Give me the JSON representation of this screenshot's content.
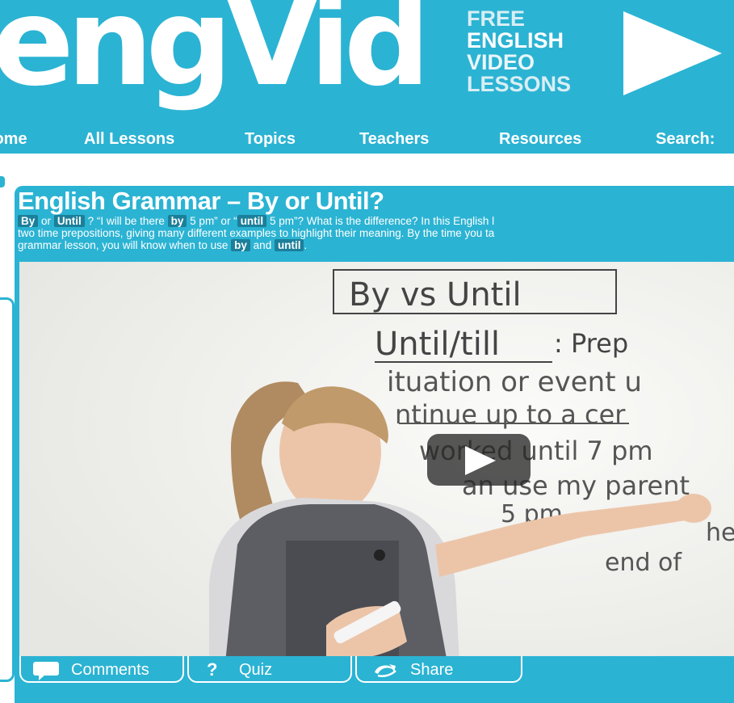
{
  "header": {
    "logo": "engVid",
    "tagline": [
      "FREE",
      "ENGLISH",
      "VIDEO",
      "LESSONS"
    ]
  },
  "nav": {
    "items": [
      "Home",
      "All Lessons",
      "Topics",
      "Teachers",
      "Resources",
      "Search:"
    ]
  },
  "lesson": {
    "title": "English Grammar – By or Until?",
    "desc": {
      "kw_by": "By",
      "w_or": "or",
      "kw_until": "Until",
      "t_quote1": "? “I will be there",
      "kw_by2": "by",
      "t_mid": "5 pm” or “",
      "kw_until2": "until",
      "t_end1": "5 pm”? What is the difference? In this English l",
      "line2": "two time prepositions, giving many different examples to highlight their meaning. By the time you ta",
      "t_line3": "grammar lesson, you will know when to use",
      "kw_by3": "by",
      "w_and": "and",
      "kw_until3": "until",
      "t_period": "."
    }
  },
  "whiteboard": {
    "title": "By vs Until",
    "heading": "Until/till",
    "heading_suffix": ": Prep",
    "lines": [
      "ituation  or  event  u",
      "ntinue  up  to  a  cer",
      "worked  until  7 pm",
      "an  use  my  parent",
      "5 pm",
      "he",
      "end of"
    ]
  },
  "tabs": {
    "comments": "Comments",
    "quiz": "Quiz",
    "share": "Share"
  },
  "colors": {
    "brand": "#2bb3d3",
    "keyword_bg": "#1c7f9a"
  }
}
